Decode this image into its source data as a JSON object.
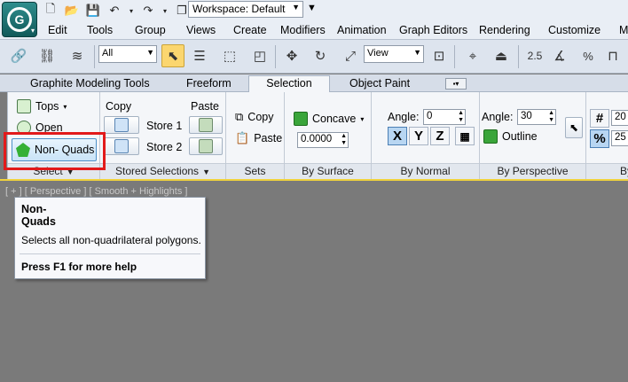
{
  "quick_access": {
    "workspace_value": "Workspace: Default"
  },
  "menu": {
    "items": [
      "Edit",
      "Tools",
      "Group",
      "Views",
      "Create",
      "Modifiers",
      "Animation",
      "Graph Editors",
      "Rendering",
      "Customize",
      "M"
    ]
  },
  "main_toolbar": {
    "selection_filter": "All",
    "reference_coord": "View",
    "snap_value": "2.5",
    "percent_label": "%"
  },
  "ribbon_tabs": {
    "items": [
      "Graphite Modeling Tools",
      "Freeform",
      "Selection",
      "Object Paint"
    ],
    "active": "Selection"
  },
  "select_panel": {
    "tops": "Tops",
    "open": "Open",
    "non_quads": "Non- Quads",
    "label": "Select"
  },
  "stored_panel": {
    "copy": "Copy",
    "paste": "Paste",
    "store1": "Store 1",
    "store2": "Store 2",
    "label": "Stored Selections"
  },
  "sets_panel": {
    "copy": "Copy",
    "paste": "Paste",
    "label": "Sets"
  },
  "surface_panel": {
    "mode": "Concave",
    "value": "0.0000",
    "label": "By Surface"
  },
  "normal_panel": {
    "angle_label": "Angle:",
    "angle_value": "0",
    "x": "X",
    "y": "Y",
    "z": "Z",
    "label": "By Normal"
  },
  "perspective_panel": {
    "angle_label": "Angle:",
    "angle_value": "30",
    "outline": "Outline",
    "label": "By Perspective"
  },
  "random_panel": {
    "value1": "20",
    "value2": "25",
    "label": "By"
  },
  "viewport": {
    "label": "[ + ] [ Perspective ] [ Smooth + Highlights ]"
  },
  "tooltip": {
    "title": "Non- Quads",
    "description": "Selects all non-quadrilateral polygons.",
    "help": "Press F1 for more help"
  }
}
